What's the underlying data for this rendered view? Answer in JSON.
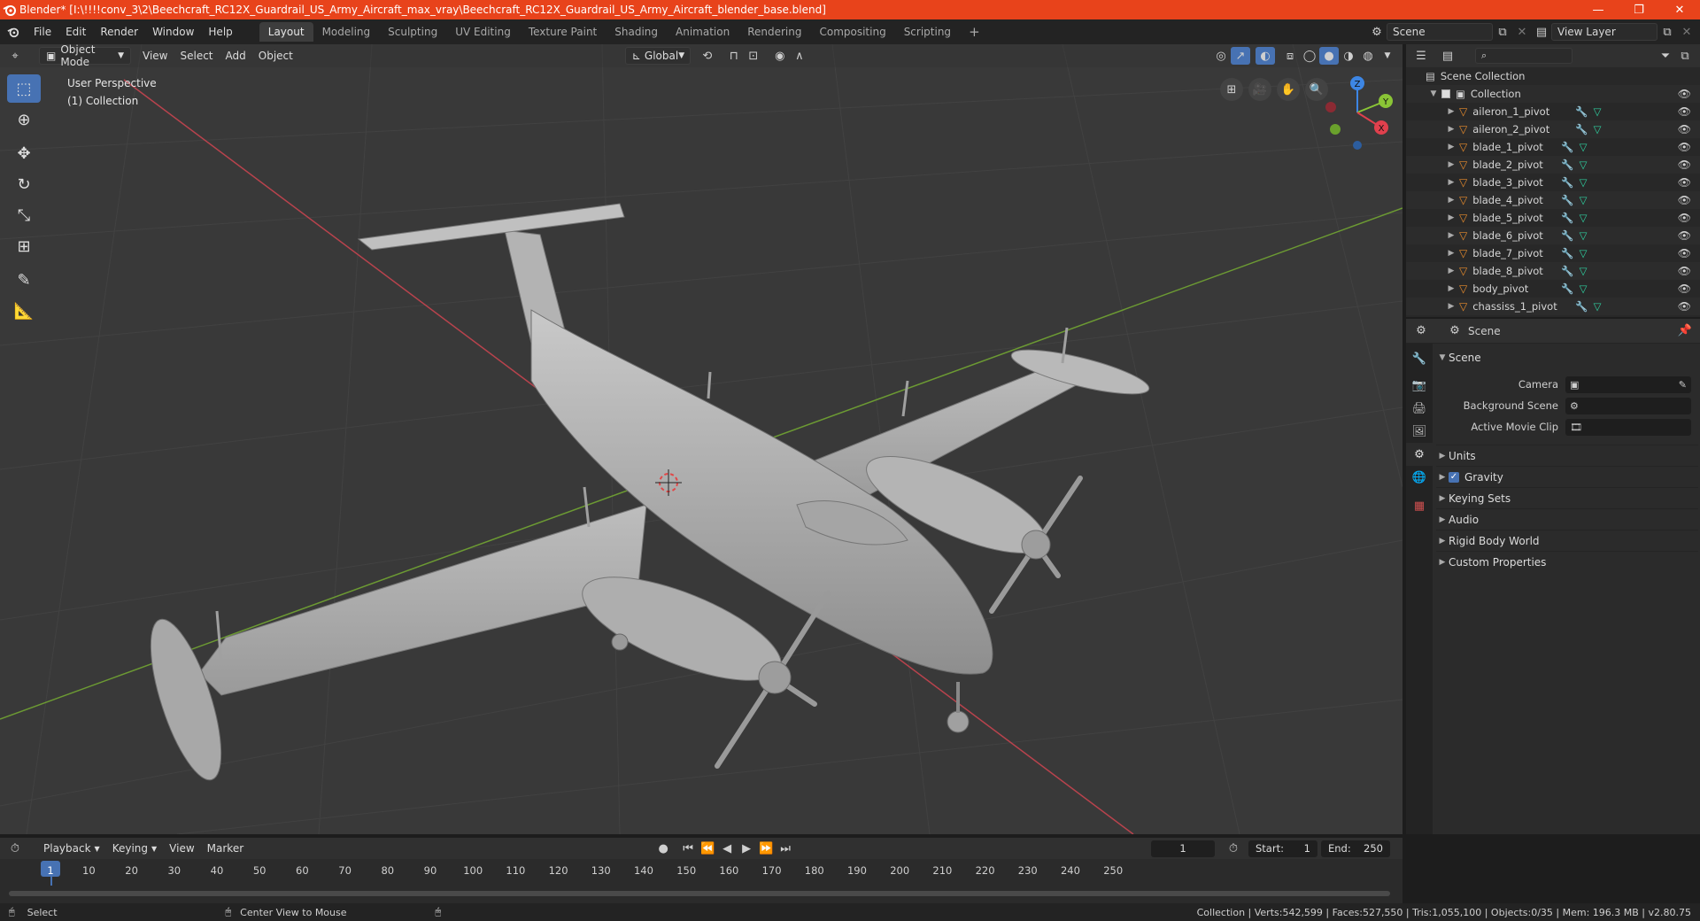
{
  "window": {
    "title": "Blender* [I:\\!!!!conv_3\\2\\Beechcraft_RC12X_Guardrail_US_Army_Aircraft_max_vray\\Beechcraft_RC12X_Guardrail_US_Army_Aircraft_blender_base.blend]",
    "minimize": "—",
    "maximize": "❐",
    "close": "✕"
  },
  "menubar": {
    "items": [
      "File",
      "Edit",
      "Render",
      "Window",
      "Help"
    ],
    "workspaces": [
      "Layout",
      "Modeling",
      "Sculpting",
      "UV Editing",
      "Texture Paint",
      "Shading",
      "Animation",
      "Rendering",
      "Compositing",
      "Scripting"
    ],
    "add_tab": "+",
    "scene": "Scene",
    "view_layer": "View Layer"
  },
  "viewport": {
    "mode": "Object Mode",
    "menus": [
      "View",
      "Select",
      "Add",
      "Object"
    ],
    "transform_orientation": "Global",
    "overlay_line1": "User Perspective",
    "overlay_line2": "(1) Collection",
    "gizmo": {
      "x": "X",
      "y": "Y",
      "z": "Z"
    }
  },
  "outliner": {
    "root": "Scene Collection",
    "collection": "Collection",
    "items": [
      "aileron_1_pivot",
      "aileron_2_pivot",
      "blade_1_pivot",
      "blade_2_pivot",
      "blade_3_pivot",
      "blade_4_pivot",
      "blade_5_pivot",
      "blade_6_pivot",
      "blade_7_pivot",
      "blade_8_pivot",
      "body_pivot",
      "chassiss_1_pivot"
    ]
  },
  "properties": {
    "context": "Scene",
    "panel": "Scene",
    "fields": [
      {
        "label": "Camera",
        "value": ""
      },
      {
        "label": "Background Scene",
        "value": ""
      },
      {
        "label": "Active Movie Clip",
        "value": ""
      }
    ],
    "subpanels": [
      "Units",
      "Gravity",
      "Keying Sets",
      "Audio",
      "Rigid Body World",
      "Custom Properties"
    ]
  },
  "timeline": {
    "menus": [
      "Playback",
      "Keying",
      "View",
      "Marker"
    ],
    "current_frame": "1",
    "start_label": "Start:",
    "start": "1",
    "end_label": "End:",
    "end": "250",
    "ruler": [
      "1",
      "10",
      "20",
      "30",
      "40",
      "50",
      "60",
      "70",
      "80",
      "90",
      "100",
      "110",
      "120",
      "130",
      "140",
      "150",
      "160",
      "170",
      "180",
      "190",
      "200",
      "210",
      "220",
      "230",
      "240",
      "250"
    ]
  },
  "statusbar": {
    "left": "Select",
    "middle": "Center View to Mouse",
    "right": "Collection | Verts:542,599 | Faces:527,550 | Tris:1,055,100 | Objects:0/35 | Mem: 196.3 MB | v2.80.75"
  },
  "colors": {
    "titlebar": "#e8431b",
    "accent": "#4772b3",
    "x_axis": "#e0404d",
    "y_axis": "#8ac536",
    "z_axis": "#3d86e4",
    "object_icon": "#e98c2c",
    "modifier_icon": "#6fa8ff",
    "mesh_icon": "#2fd0a0"
  }
}
